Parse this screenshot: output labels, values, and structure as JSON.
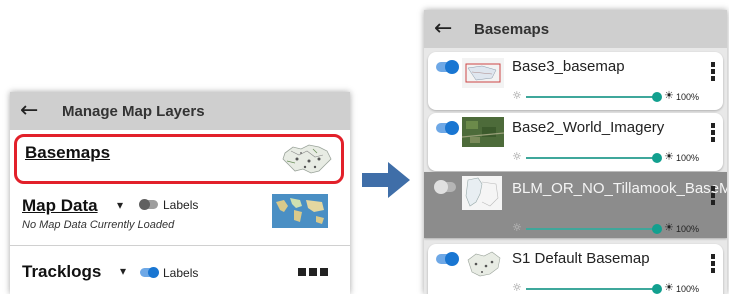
{
  "manage_layers": {
    "title": "Manage Map Layers",
    "basemaps_label": "Basemaps",
    "map_data": {
      "title": "Map Data",
      "subtitle": "No Map Data Currently Loaded",
      "labels_toggle": {
        "label": "Labels",
        "on": false
      }
    },
    "tracklogs": {
      "title": "Tracklogs",
      "labels_toggle": {
        "label": "Labels",
        "on": true
      }
    }
  },
  "basemaps_screen": {
    "title": "Basemaps",
    "items": [
      {
        "name": "Base3_basemap",
        "enabled": true,
        "opacity": "100%"
      },
      {
        "name": "Base2_World_Imagery",
        "enabled": true,
        "opacity": "100%"
      },
      {
        "name": "BLM_OR_NO_Tillamook_BaseMap",
        "enabled": false,
        "opacity": "100%"
      },
      {
        "name": "S1 Default Basemap",
        "enabled": true,
        "opacity": "100%"
      }
    ]
  },
  "icons": {
    "back": "arrow-left-icon",
    "chevron": "chevron-down-icon",
    "menu": "kebab-menu-icon",
    "brightness": "sun-icon",
    "flow": "arrow-right-icon"
  },
  "colors": {
    "accent_teal": "#12a08f",
    "toggle_on": "#1976d2",
    "highlight_red": "#e2202a",
    "header_gray": "#cfcfcf"
  }
}
